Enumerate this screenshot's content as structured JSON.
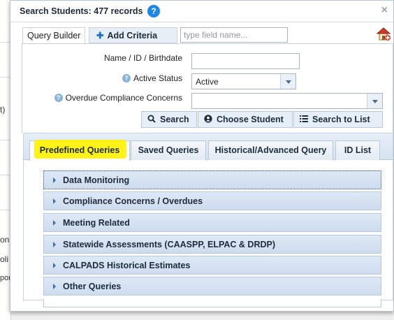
{
  "background": {
    "fragments": [
      "t)",
      "on",
      "oli",
      "pon"
    ]
  },
  "dialog": {
    "title": "Search Students: 477 records",
    "help_glyph": "?",
    "close_glyph": "×"
  },
  "toolbar": {
    "query_builder_label": "Query Builder",
    "add_criteria_label": "Add Criteria",
    "field_search_placeholder": "type field name..."
  },
  "query": {
    "name_label": "Name / ID / Birthdate",
    "name_value": "",
    "active_status_label": "Active Status",
    "active_status_value": "Active",
    "overdue_label": "Overdue Compliance Concerns",
    "overdue_value": "",
    "help_glyph": "?"
  },
  "actions": {
    "search_label": "Search",
    "choose_student_label": "Choose Student",
    "search_to_list_label": "Search to List"
  },
  "tabs": [
    {
      "label": "Predefined Queries",
      "active": true
    },
    {
      "label": "Saved Queries",
      "active": false
    },
    {
      "label": "Historical/Advanced Query",
      "active": false
    },
    {
      "label": "ID List",
      "active": false
    }
  ],
  "accordion": [
    {
      "label": "Data Monitoring"
    },
    {
      "label": "Compliance Concerns / Overdues"
    },
    {
      "label": "Meeting Related"
    },
    {
      "label": "Statewide Assessments (CAASPP, ELPAC & DRDP)"
    },
    {
      "label": "CALPADS Historical Estimates"
    },
    {
      "label": "Other Queries"
    }
  ],
  "colors": {
    "accent": "#1e88e5",
    "highlight": "#fff200",
    "accordion_header": "#d5e2f2"
  }
}
